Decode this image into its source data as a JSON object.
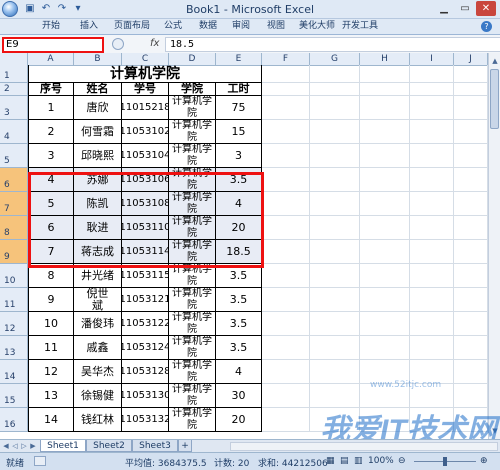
{
  "window": {
    "title": "Book1 - Microsoft Excel"
  },
  "ribbon": {
    "tabs": [
      "开始",
      "插入",
      "页面布局",
      "公式",
      "数据",
      "审阅",
      "视图",
      "美化大师",
      "开发工具"
    ]
  },
  "formula_bar": {
    "name_box": "E9",
    "fx": "fx",
    "value": "18.5"
  },
  "columns": [
    "A",
    "B",
    "C",
    "D",
    "E",
    "F",
    "G",
    "H",
    "I",
    "J"
  ],
  "sheet": {
    "title": "计算机学院",
    "headers": [
      "序号",
      "姓名",
      "学号",
      "学院",
      "工时"
    ],
    "rows": [
      {
        "row": "3",
        "seq": "1",
        "name": "唐欣",
        "id": "11015218",
        "college": "计算机学\n院",
        "hours": "75"
      },
      {
        "row": "4",
        "seq": "2",
        "name": "何雪霜",
        "id": "11053102",
        "college": "计算机学\n院",
        "hours": "15"
      },
      {
        "row": "5",
        "seq": "3",
        "name": "邱晓熙",
        "id": "11053104",
        "college": "计算机学\n院",
        "hours": "3"
      },
      {
        "row": "6",
        "seq": "4",
        "name": "苏娜",
        "id": "11053106",
        "college": "计算机学\n院",
        "hours": "3.5"
      },
      {
        "row": "7",
        "seq": "5",
        "name": "陈凯",
        "id": "11053108",
        "college": "计算机学\n院",
        "hours": "4"
      },
      {
        "row": "8",
        "seq": "6",
        "name": "耿进",
        "id": "11053110",
        "college": "计算机学\n院",
        "hours": "20"
      },
      {
        "row": "9",
        "seq": "7",
        "name": "蒋志成",
        "id": "11053114",
        "college": "计算机学\n院",
        "hours": "18.5"
      },
      {
        "row": "10",
        "seq": "8",
        "name": "井光绪",
        "id": "11053115",
        "college": "计算机学\n院",
        "hours": "3.5"
      },
      {
        "row": "11",
        "seq": "9",
        "name": "倪世\n斌",
        "id": "11053121",
        "college": "计算机学\n院",
        "hours": "3.5"
      },
      {
        "row": "12",
        "seq": "10",
        "name": "潘俊玮",
        "id": "11053122",
        "college": "计算机学\n院",
        "hours": "3.5"
      },
      {
        "row": "13",
        "seq": "11",
        "name": "戚鑫",
        "id": "11053124",
        "college": "计算机学\n院",
        "hours": "3.5"
      },
      {
        "row": "14",
        "seq": "12",
        "name": "吴华杰",
        "id": "11053128",
        "college": "计算机学\n院",
        "hours": "4"
      },
      {
        "row": "15",
        "seq": "13",
        "name": "徐锡健",
        "id": "11053130",
        "college": "计算机学\n院",
        "hours": "30"
      },
      {
        "row": "16",
        "seq": "14",
        "name": "钱红林",
        "id": "11053132",
        "college": "计算机学\n院",
        "hours": "20"
      }
    ]
  },
  "row_labels": {
    "title": "1",
    "header": "2"
  },
  "sheet_tabs": [
    "Sheet1",
    "Sheet2",
    "Sheet3"
  ],
  "status": {
    "mode": "就绪",
    "average": "平均值: 3684375.5",
    "count": "计数: 20",
    "sum": "求和: 44212506",
    "zoom": "100%"
  },
  "watermark": {
    "text": "我爱IT技术网",
    "url": "www.52itjc.com"
  },
  "colors": {
    "selection": "#ee1111",
    "header_bg": "#e4ecf7",
    "selected_row_header": "#f6c37b"
  }
}
